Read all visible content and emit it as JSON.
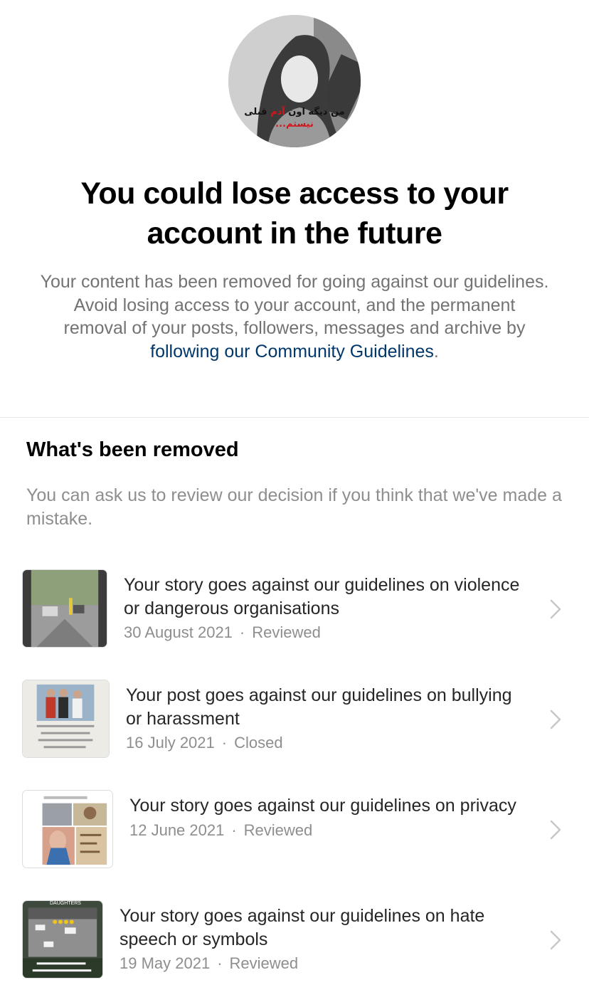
{
  "header": {
    "avatar_caption_a": "من دیگه اون ",
    "avatar_caption_red": "آدم",
    "avatar_caption_b": " قبلی",
    "avatar_caption_c": "نیستم...",
    "headline": "You could lose access to your account in the future",
    "intro": "Your content has been removed for going against our guidelines. Avoid losing access to your account, and the permanent removal of your posts, followers, messages and archive by ",
    "intro_link": "following our Community Guidelines",
    "intro_end": "."
  },
  "removed": {
    "title": "What's been removed",
    "subtitle": "You can ask us to review our decision if you think that we've made a mistake.",
    "items": [
      {
        "title": "Your story goes against our guidelines on violence or dangerous organisations",
        "date": "30 August 2021",
        "status": "Reviewed",
        "thumb_icon": "street-photo-thumbnail"
      },
      {
        "title": "Your post goes against our guidelines on bullying or harassment",
        "date": "16 July 2021",
        "status": "Closed",
        "thumb_icon": "group-photo-thumbnail"
      },
      {
        "title": "Your story goes against our guidelines on privacy",
        "date": "12 June 2021",
        "status": "Reviewed",
        "thumb_icon": "collage-thumbnail"
      },
      {
        "title": "Your story goes against our guidelines on hate speech or symbols",
        "date": "19 May 2021",
        "status": "Reviewed",
        "thumb_icon": "street-video-thumbnail"
      }
    ],
    "separator": "·",
    "thumb_overlay_text": "DAUGHTERS"
  },
  "colors": {
    "link": "#00376b",
    "secondary_text": "#8e8e8e",
    "primary_text": "#262626",
    "divider": "#e6e6e6"
  }
}
